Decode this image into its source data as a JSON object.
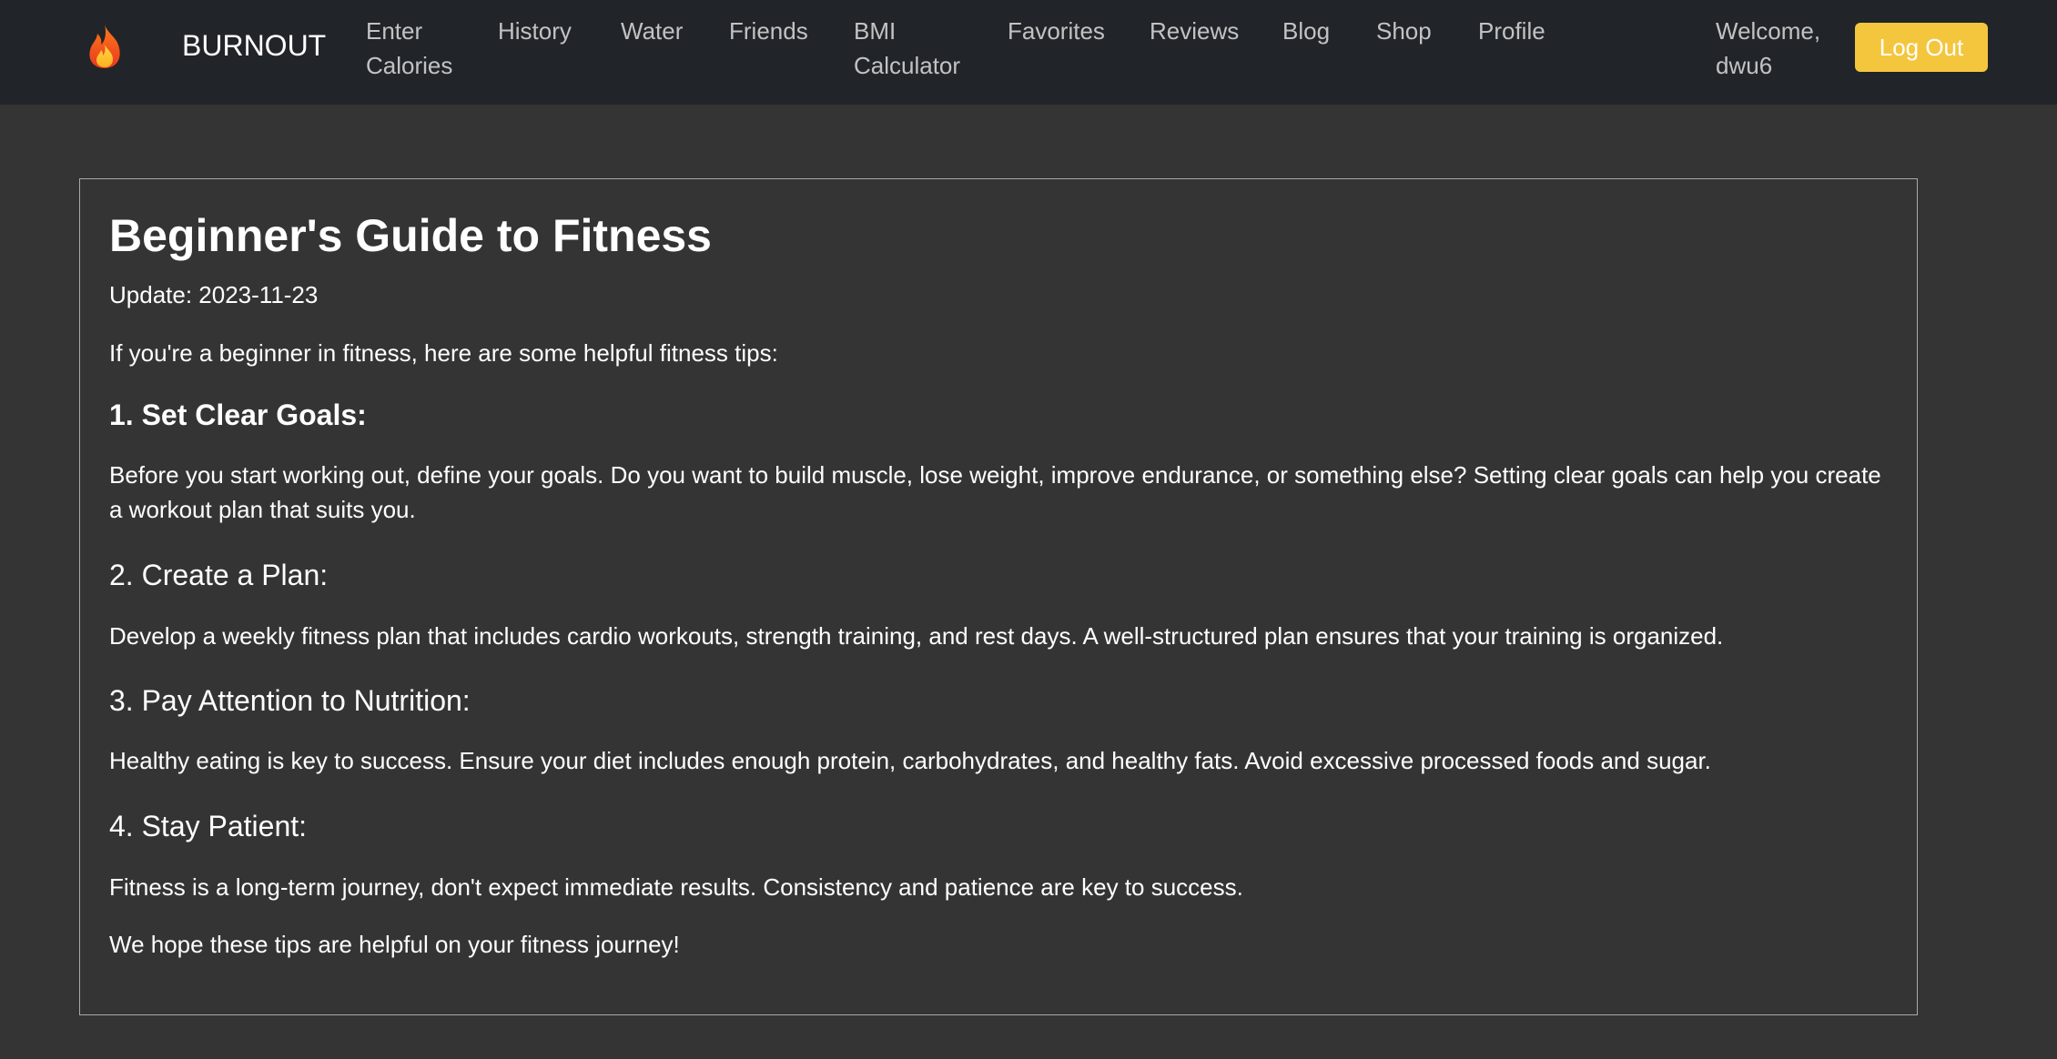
{
  "navbar": {
    "brand_icon": "fire-icon",
    "brand_name": "BURNOUT",
    "links": [
      {
        "label_lines": [
          "Enter",
          "Calories"
        ]
      },
      {
        "label_lines": [
          "History"
        ]
      },
      {
        "label_lines": [
          "Water"
        ]
      },
      {
        "label_lines": [
          "Friends"
        ]
      },
      {
        "label_lines": [
          "BMI",
          "Calculator"
        ]
      },
      {
        "label_lines": [
          "Favorites"
        ]
      },
      {
        "label_lines": [
          "Reviews"
        ]
      },
      {
        "label_lines": [
          "Blog"
        ]
      },
      {
        "label_lines": [
          "Shop"
        ]
      },
      {
        "label_lines": [
          "Profile"
        ]
      }
    ],
    "welcome_lines": [
      "Welcome,",
      "dwu6"
    ],
    "logout_label": "Log Out",
    "accent_color": "#f4c63d",
    "background_color": "#212428"
  },
  "article": {
    "title": "Beginner's Guide to Fitness",
    "update": "Update: 2023-11-23",
    "intro": "If you're a beginner in fitness, here are some helpful fitness tips:",
    "sections": [
      {
        "heading": "1. Set Clear Goals:",
        "body": "Before you start working out, define your goals. Do you want to build muscle, lose weight, improve endurance, or something else? Setting clear goals can help you create a workout plan that suits you."
      },
      {
        "heading": "2. Create a Plan:",
        "body": "Develop a weekly fitness plan that includes cardio workouts, strength training, and rest days. A well-structured plan ensures that your training is organized."
      },
      {
        "heading": "3. Pay Attention to Nutrition:",
        "body": "Healthy eating is key to success. Ensure your diet includes enough protein, carbohydrates, and healthy fats. Avoid excessive processed foods and sugar."
      },
      {
        "heading": "4. Stay Patient:",
        "body": "Fitness is a long-term journey, don't expect immediate results. Consistency and patience are key to success."
      }
    ],
    "closing": "We hope these tips are helpful on your fitness journey!"
  },
  "page_background": "#343434"
}
